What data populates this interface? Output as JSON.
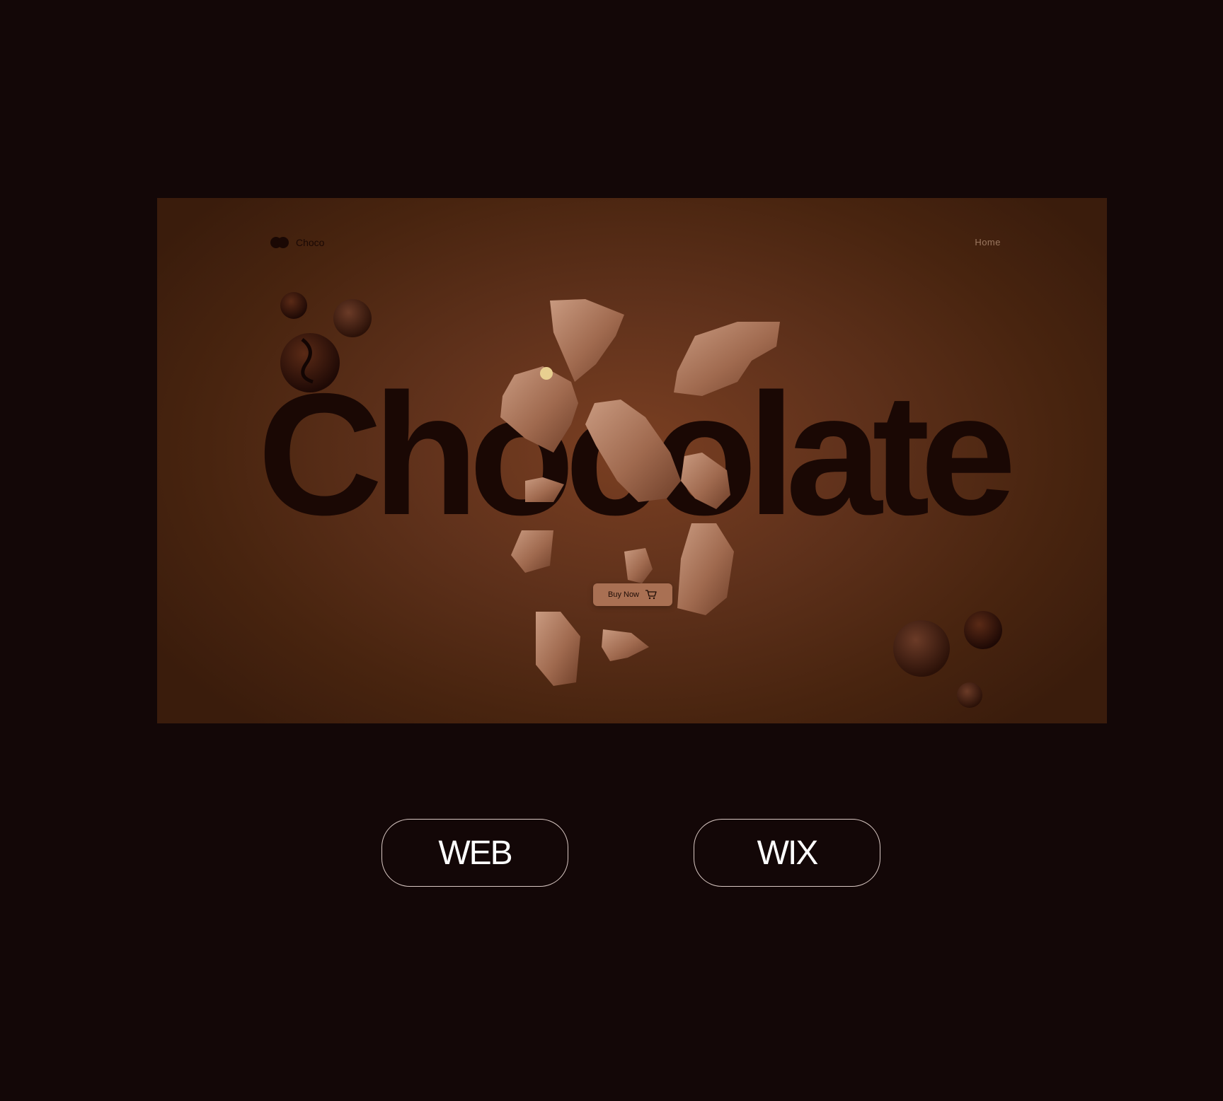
{
  "hero": {
    "brand": "Choco",
    "nav_home": "Home",
    "headline": "Chocolate",
    "buy_label": "Buy Now"
  },
  "buttons": {
    "web": "WEB",
    "wix": "WIX"
  },
  "colors": {
    "page_bg": "#130707",
    "hero_center": "#7a3f22",
    "hero_edge": "#3a1c0c",
    "headline": "#1a0804",
    "buy_bg": "#a97053",
    "pill_border": "#d9c8c3"
  }
}
